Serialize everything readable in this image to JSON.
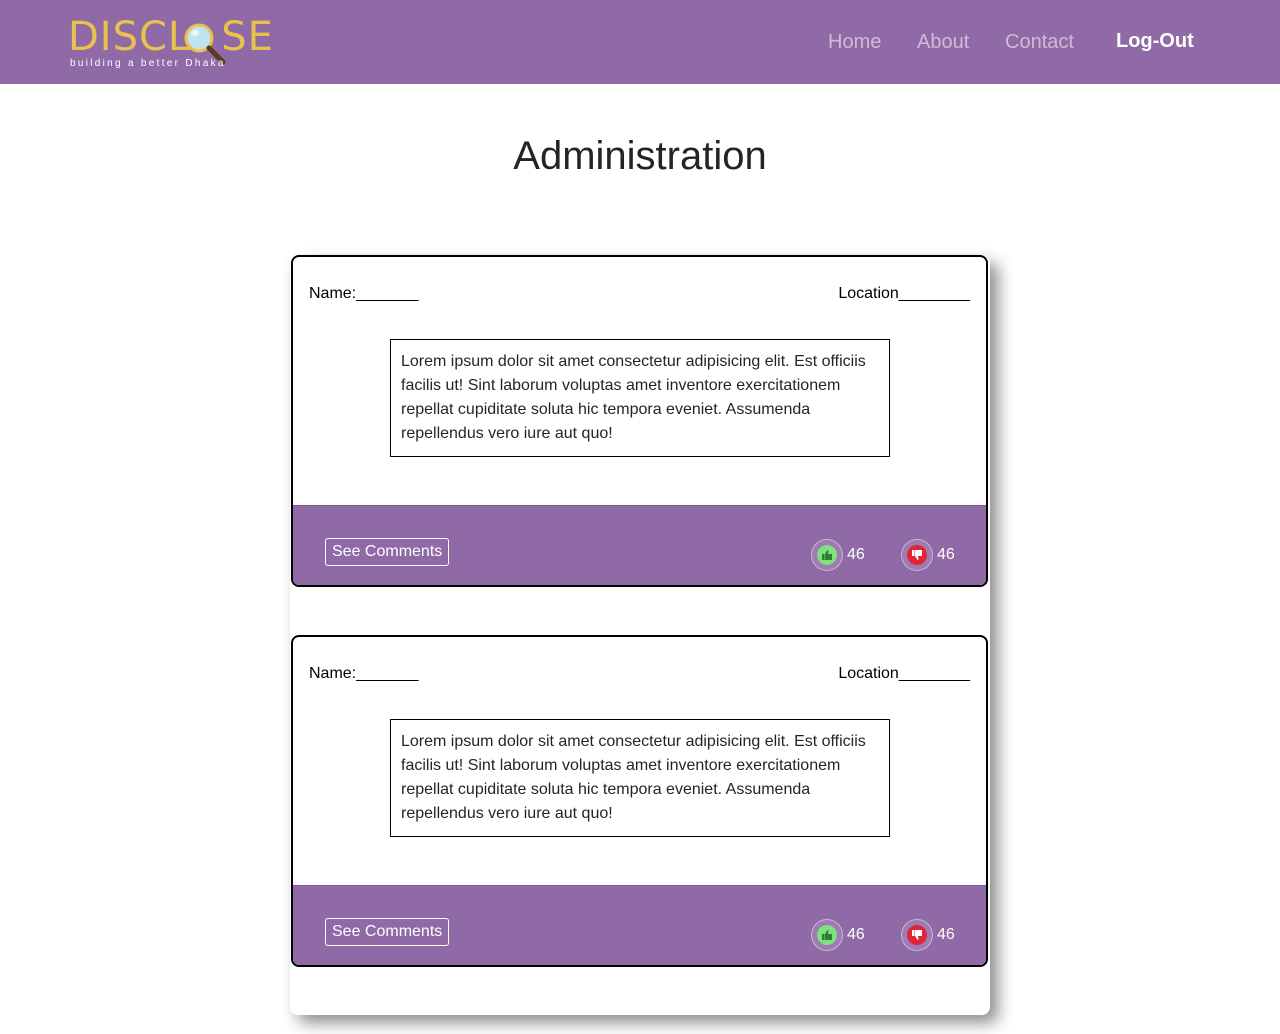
{
  "brand": {
    "name_start": "DISCL",
    "name_end": "SE",
    "tagline": "building a better Dhaka",
    "accent": "#e8c24b"
  },
  "nav": {
    "home": "Home",
    "about": "About",
    "contact": "Contact",
    "logout": "Log-Out",
    "background": "#8f6aa7"
  },
  "page_title": "Administration",
  "posts": [
    {
      "name_label": "Name:_______",
      "location_label": "Location________",
      "body": "Lorem ipsum dolor sit amet consectetur adipisicing elit. Est officiis facilis ut! Sint laborum voluptas amet inventore exercitationem repellat cupiditate soluta hic tempora eveniet. Assumenda repellendus vero iure aut quo!",
      "comments_label": "See Comments",
      "upvotes": "46",
      "downvotes": "46",
      "upvote_icon": "thumbs-up-icon",
      "downvote_icon": "thumbs-down-icon"
    },
    {
      "name_label": "Name:_______",
      "location_label": "Location________",
      "body": "Lorem ipsum dolor sit amet consectetur adipisicing elit. Est officiis facilis ut! Sint laborum voluptas amet inventore exercitationem repellat cupiditate soluta hic tempora eveniet. Assumenda repellendus vero iure aut quo!",
      "comments_label": "See Comments",
      "upvotes": "46",
      "downvotes": "46",
      "upvote_icon": "thumbs-up-icon",
      "downvote_icon": "thumbs-down-icon"
    }
  ],
  "colors": {
    "upvote": "#7ee07e",
    "downvote": "#e0243a"
  }
}
